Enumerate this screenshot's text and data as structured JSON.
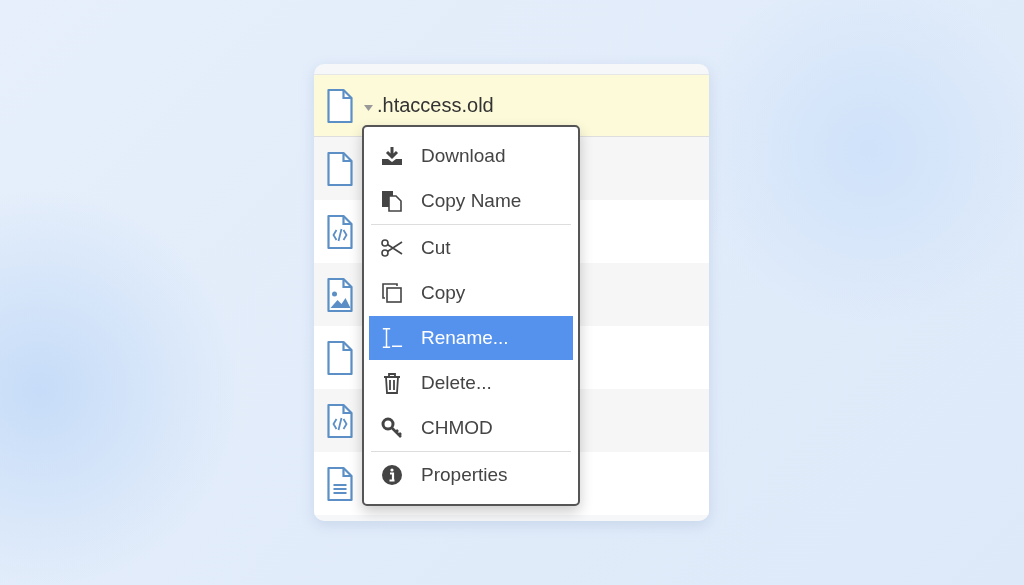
{
  "files": [
    {
      "kind": "blank",
      "name": ".htaccess.old",
      "selected": true
    },
    {
      "kind": "blank",
      "selected": false
    },
    {
      "kind": "code",
      "selected": false
    },
    {
      "kind": "image",
      "selected": false
    },
    {
      "kind": "blank",
      "selected": false
    },
    {
      "kind": "code",
      "selected": false
    },
    {
      "kind": "text",
      "selected": false
    }
  ],
  "context_menu": {
    "groups": [
      [
        {
          "label": "Download",
          "selected": false
        },
        {
          "label": "Copy Name",
          "selected": false
        }
      ],
      [
        {
          "label": "Cut",
          "selected": false
        },
        {
          "label": "Copy",
          "selected": false
        },
        {
          "label": "Rename...",
          "selected": true
        },
        {
          "label": "Delete...",
          "selected": false
        },
        {
          "label": "CHMOD",
          "selected": false
        }
      ],
      [
        {
          "label": "Properties",
          "selected": false
        }
      ]
    ]
  }
}
